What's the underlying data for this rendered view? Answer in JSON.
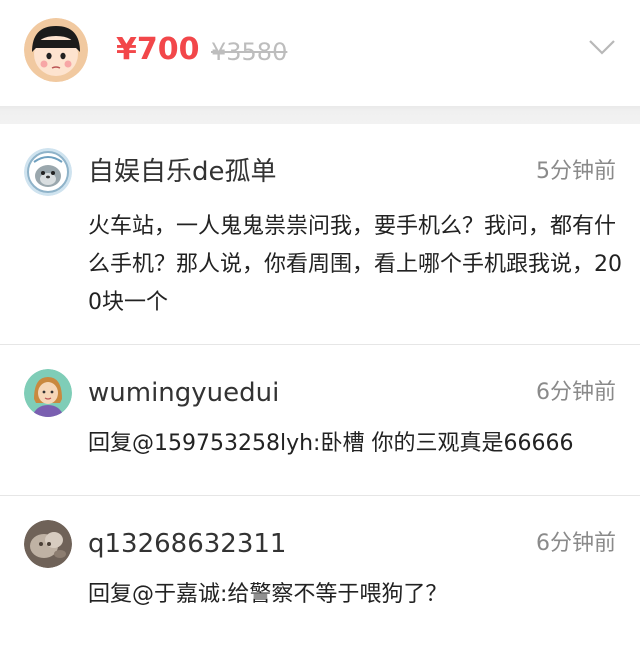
{
  "header": {
    "price": "¥700",
    "original_price": "¥3580",
    "avatar_icon": "cartoon-girl-avatar-icon",
    "expand_icon": "chevron-down-icon"
  },
  "comments": [
    {
      "username": "自娱自乐de孤单",
      "time": "5分钟前",
      "text": "火车站，一人鬼鬼祟祟问我，要手机么？我问，都有什么手机？那人说，你看周围，看上哪个手机跟我说，200块一个",
      "avatar_icon": "seal-astronaut-avatar-icon"
    },
    {
      "username": "wumingyuedui",
      "time": "6分钟前",
      "text": "回复@159753258lyh:卧槽 你的三观真是66666",
      "avatar_icon": "woman-avatar-icon"
    },
    {
      "username": "q13268632311",
      "time": "6分钟前",
      "text": "回复@于嘉诚:给警察不等于喂狗了？",
      "avatar_icon": "photo-avatar-icon"
    }
  ],
  "colors": {
    "price": "#f2474a",
    "original_price": "#bdbdbd",
    "meta": "#8a8a8a",
    "divider": "#e6e6e6"
  }
}
